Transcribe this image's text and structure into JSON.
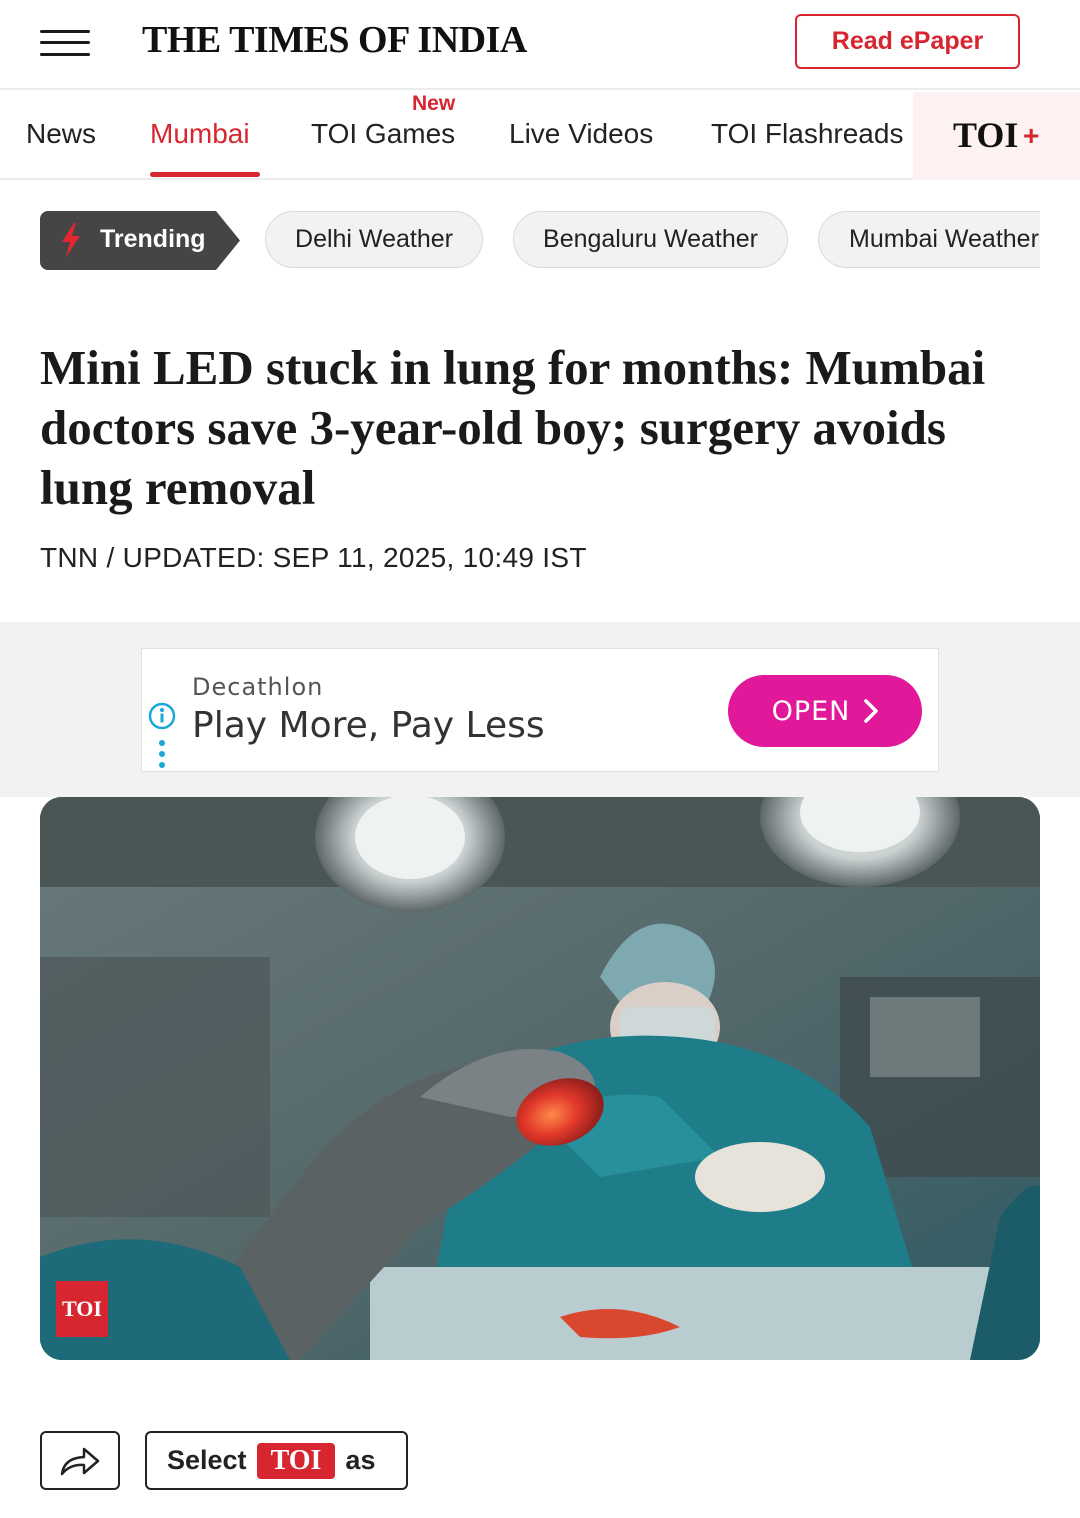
{
  "header": {
    "menu_icon": "hamburger-menu-icon",
    "logo": "THE TIMES OF INDIA",
    "epaper_label": "Read ePaper"
  },
  "nav": {
    "items": [
      {
        "label": "News",
        "active": false
      },
      {
        "label": "Mumbai",
        "active": true
      },
      {
        "label": "TOI Games",
        "active": false,
        "badge": "New"
      },
      {
        "label": "Live Videos",
        "active": false
      },
      {
        "label": "TOI Flashreads",
        "active": false
      }
    ],
    "toi_plus": {
      "label": "TOI",
      "plus": "+"
    }
  },
  "trending": {
    "label": "Trending",
    "icon": "lightning-bolt-icon",
    "chips": [
      "Delhi Weather",
      "Bengaluru Weather",
      "Mumbai Weather"
    ]
  },
  "article": {
    "headline": "Mini LED stuck in lung for months: Mumbai doctors save 3-year-old boy; surgery avoids lung removal",
    "byline": "TNN / UPDATED: SEP 11, 2025, 10:49 IST",
    "image_watermark": "TOI"
  },
  "ad": {
    "brand": "Decathlon",
    "title": "Play More, Pay Less",
    "cta": "OPEN",
    "icons": [
      "info-icon",
      "more-vertical-icon",
      "chevron-right-icon"
    ]
  },
  "actions": {
    "share_icon": "share-icon",
    "select_prefix": "Select",
    "select_brand": "TOI",
    "select_suffix": "as"
  },
  "colors": {
    "brand_red": "#d7262f",
    "ad_cta": "#e1189a",
    "trending_bg": "#454545"
  }
}
